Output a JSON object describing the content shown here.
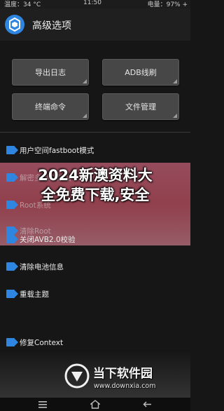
{
  "status_bar": {
    "temp": "温度：34 °C",
    "time": "11:50",
    "battery": "电量：97% +"
  },
  "header": {
    "title": "高级选项",
    "logo_icon": "twrp-logo-icon"
  },
  "buttons": [
    {
      "label": "导出日志"
    },
    {
      "label": "ADB线刷"
    },
    {
      "label": "终端命令"
    },
    {
      "label": "文件管理"
    }
  ],
  "options": [
    {
      "label": "用户空间fastboot模式"
    },
    {
      "label": "解密多用户数据"
    },
    {
      "label": "Root系统"
    },
    {
      "label": "清除Root"
    },
    {
      "label": "关闭AVB2.0校验"
    },
    {
      "label": "清除电池信息"
    },
    {
      "label": "重载主题"
    },
    {
      "label": "修复Context"
    }
  ],
  "overlay": {
    "line1": "2024新澳资料大",
    "line2": "全免费下载,安全",
    "color": "#e0607a"
  },
  "watermark": {
    "name": "当下软件园",
    "url": "www.downxia.com"
  },
  "nav": {
    "icons": [
      "menu-icon",
      "home-icon",
      "back-icon"
    ]
  },
  "colors": {
    "accent": "#2f86e0",
    "background": "#161616",
    "button": "#474747"
  }
}
